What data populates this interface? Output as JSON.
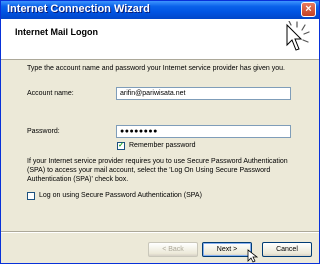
{
  "window": {
    "title": "Internet Connection Wizard",
    "close_label": "×"
  },
  "header": {
    "title": "Internet Mail Logon",
    "icon": "wizard-sparkle-icon"
  },
  "instructions": "Type the account name and password your Internet service provider has given you.",
  "account": {
    "label": "Account name:",
    "value": "arifin@pariwisata.net"
  },
  "password": {
    "label": "Password:",
    "value": "●●●●●●●●"
  },
  "remember": {
    "label": "Remember password",
    "checked": true,
    "mark": "✓"
  },
  "spa": {
    "text": "If your Internet service provider requires you to use Secure Password Authentication (SPA) to access your mail account, select the 'Log On Using Secure Password Authentication (SPA)' check box.",
    "checkbox_label": "Log on using Secure Password Authentication (SPA)",
    "checked": false
  },
  "buttons": {
    "back": "< Back",
    "next": "Next >",
    "cancel": "Cancel"
  }
}
